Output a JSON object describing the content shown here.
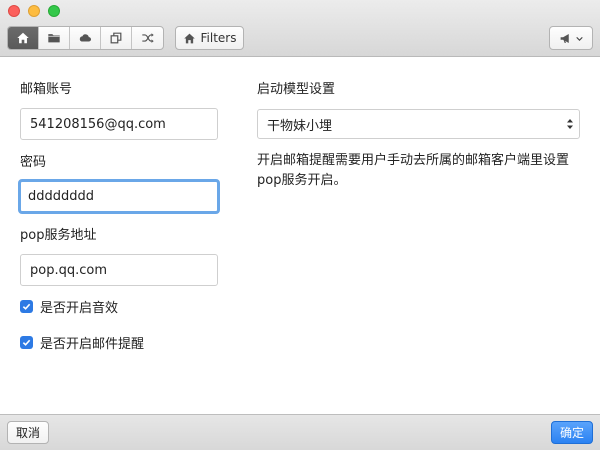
{
  "toolbar": {
    "tabs": [
      {
        "icon": "home-icon",
        "active": true
      },
      {
        "icon": "folder-icon",
        "active": false
      },
      {
        "icon": "cloud-icon",
        "active": false
      },
      {
        "icon": "copy-icon",
        "active": false
      },
      {
        "icon": "shuffle-icon",
        "active": false
      }
    ],
    "filters_label": "Filters",
    "share_icon": "megaphone-icon"
  },
  "form": {
    "email_label": "邮箱账号",
    "email_value": "541208156@qq.com",
    "password_label": "密码",
    "password_value": "dddddddd",
    "pop_label": "pop服务地址",
    "pop_value": "pop.qq.com",
    "sound_label": "是否开启音效",
    "sound_checked": true,
    "mail_alert_label": "是否开启邮件提醒",
    "mail_alert_checked": true
  },
  "model": {
    "label": "启动模型设置",
    "selected": "干物妹小埋",
    "description": "开启邮箱提醒需要用户手动去所属的邮箱客户端里设置pop服务开启。"
  },
  "footer": {
    "cancel_label": "取消",
    "ok_label": "确定"
  },
  "colors": {
    "accent": "#2d7ae4",
    "focus_ring": "#6aa7e8"
  }
}
